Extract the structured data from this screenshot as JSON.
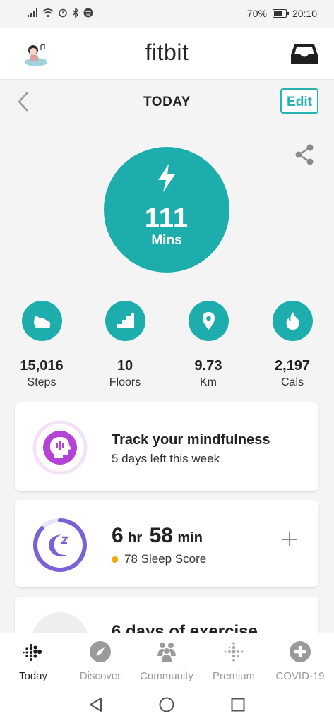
{
  "status_bar": {
    "battery": "70%",
    "time": "20:10"
  },
  "header": {
    "brand": "fitbit"
  },
  "today": {
    "title": "TODAY",
    "edit_label": "Edit"
  },
  "active_minutes": {
    "value": "111",
    "unit": "Mins"
  },
  "stats": [
    {
      "icon": "shoe-icon",
      "value": "15,016",
      "label": "Steps"
    },
    {
      "icon": "stairs-icon",
      "value": "10",
      "label": "Floors"
    },
    {
      "icon": "location-pin-icon",
      "value": "9.73",
      "label": "Km"
    },
    {
      "icon": "flame-icon",
      "value": "2,197",
      "label": "Cals"
    }
  ],
  "mindfulness_card": {
    "title": "Track your mindfulness",
    "subtitle": "5 days left this week"
  },
  "sleep_card": {
    "hours": "6",
    "hours_unit": "hr",
    "minutes": "58",
    "minutes_unit": "min",
    "score_text": "78 Sleep Score"
  },
  "exercise_card": {
    "title": "6 days of exercise"
  },
  "bottom_nav": [
    {
      "label": "Today",
      "icon": "fitbit-dots-icon",
      "active": true
    },
    {
      "label": "Discover",
      "icon": "compass-icon",
      "active": false
    },
    {
      "label": "Community",
      "icon": "community-icon",
      "active": false
    },
    {
      "label": "Premium",
      "icon": "premium-dots-icon",
      "active": false
    },
    {
      "label": "COVID-19",
      "icon": "plus-circle-icon",
      "active": false
    }
  ],
  "colors": {
    "teal": "#1dadad",
    "accent": "#27b3b2",
    "mindfulness": "#b542d6",
    "sleep": "#7b61d6",
    "score_dot": "#f0a800"
  }
}
